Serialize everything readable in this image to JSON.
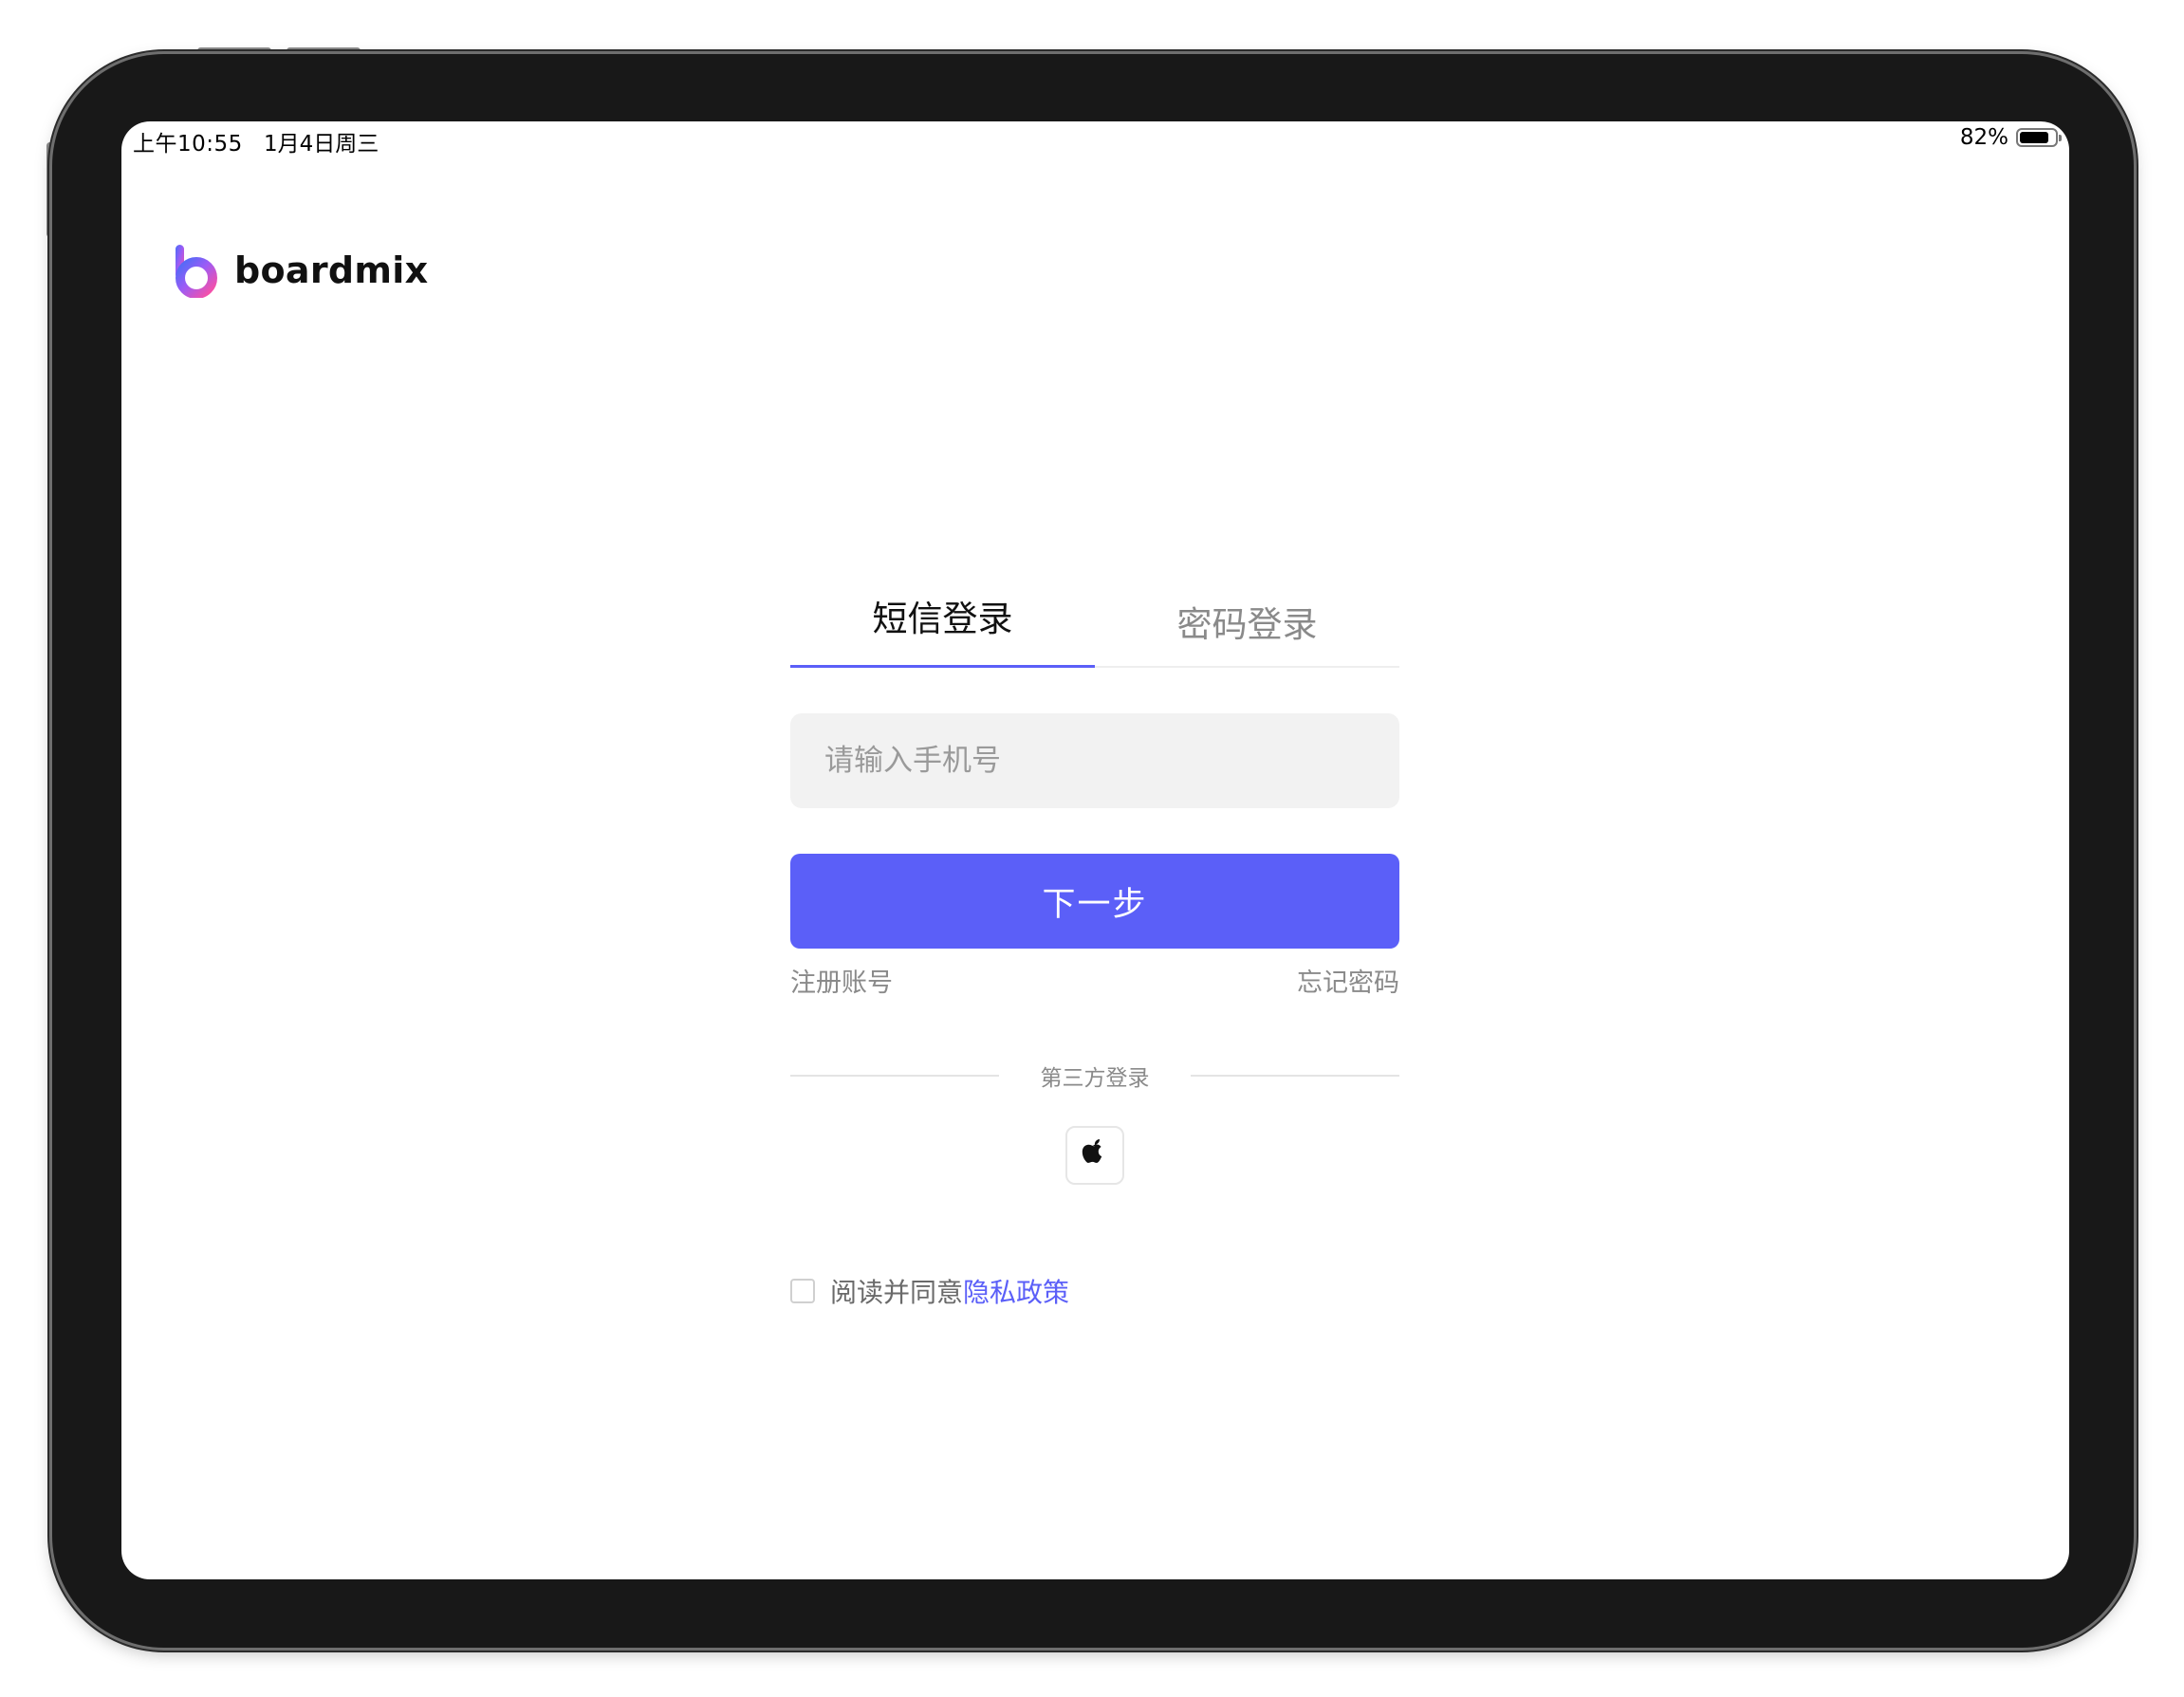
{
  "status_bar": {
    "time": "上午10:55",
    "date": "1月4日周三",
    "battery_percent": "82%",
    "battery_level": 0.82
  },
  "logo": {
    "text": "boardmix",
    "icon": "boardmix-logo-icon"
  },
  "tabs": [
    {
      "label": "短信登录",
      "active": true
    },
    {
      "label": "密码登录",
      "active": false
    }
  ],
  "phone_input": {
    "placeholder": "请输入手机号",
    "value": ""
  },
  "next_button": {
    "label": "下一步"
  },
  "links": {
    "register": "注册账号",
    "forgot_password": "忘记密码"
  },
  "third_party": {
    "label": "第三方登录",
    "providers": [
      {
        "name": "apple",
        "icon": "apple-icon"
      }
    ]
  },
  "agreement": {
    "checked": false,
    "prefix": "阅读并同意",
    "link": "隐私政策"
  },
  "colors": {
    "accent": "#5b5ff8",
    "input_bg": "#f2f2f2",
    "muted_text": "#8a8a8a",
    "frame": "#181818"
  }
}
